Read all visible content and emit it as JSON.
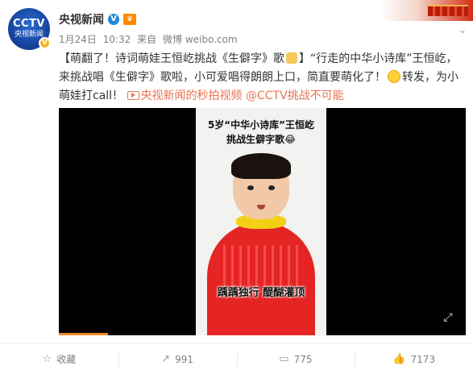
{
  "account": {
    "name": "央视新闻",
    "avatar_logo": "CCTV",
    "avatar_sub": "央视新闻",
    "verified_icon": "verified-badge-icon",
    "member_icon": "member-icon"
  },
  "meta": {
    "date": "1月24日",
    "time": "10:32",
    "via_label": "来自",
    "source": "微博 weibo.com"
  },
  "post": {
    "line_1_prefix": "【萌翻了！诗词萌娃王恒屹挑战《生僻字》歌",
    "line_1_suffix": "】“行走的中华小诗库”王恒屹，",
    "line_2": "来挑战唱《生僻字》歌啦，小可爱唱得朗朗上口，简直要萌化了！",
    "line_2_suffix": "转发，为小",
    "line_3_prefix": "萌娃打call！",
    "video_link": "央视新闻的秒拍视频",
    "mention": "@CCTV挑战不可能"
  },
  "video": {
    "caption_line1": "5岁“中华小诗库”王恒屹",
    "caption_line2": "挑战生僻字歌😂",
    "subtitle": "踽踽独行 醍醐灌顶",
    "progress_fraction": 0.12
  },
  "actions": {
    "favorite_label": "收藏",
    "repost_count": "991",
    "comment_count": "775",
    "like_count": "7173"
  },
  "colors": {
    "link": "#eb7350",
    "text": "#333333",
    "muted": "#808080",
    "verified": "#1e8bd6"
  }
}
